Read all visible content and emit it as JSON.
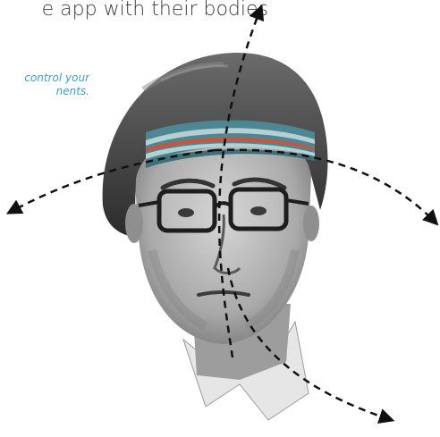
{
  "headline": {
    "text": "e app with their bodies"
  },
  "subtitle": {
    "line1": "control your",
    "line2": "nents."
  },
  "illustration": {
    "subject": "man-with-headband-portrait",
    "headband_colors": [
      "#4d8794",
      "#b5d0d2",
      "#c8553d",
      "#3f6f7a"
    ],
    "arrow_style": "dashed",
    "arrow_directions": [
      "up",
      "left",
      "right",
      "down-right"
    ]
  },
  "colors": {
    "accent": "#3fa0c9",
    "text": "#3a3a3a",
    "background": "#ffffff"
  }
}
